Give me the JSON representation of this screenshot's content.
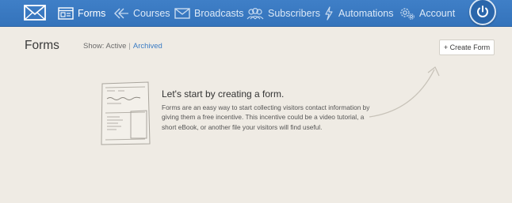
{
  "nav": {
    "items": [
      {
        "label": "Forms",
        "icon": "form-icon",
        "active": true
      },
      {
        "label": "Courses",
        "icon": "courses-icon",
        "active": false
      },
      {
        "label": "Broadcasts",
        "icon": "broadcast-icon",
        "active": false
      },
      {
        "label": "Subscribers",
        "icon": "subscribers-icon",
        "active": false
      },
      {
        "label": "Automations",
        "icon": "lightning-icon",
        "active": false
      },
      {
        "label": "Account",
        "icon": "gear-icon",
        "active": false
      }
    ],
    "colors": {
      "bar": "#3776be",
      "text": "#dce9f7",
      "active_text": "#ffffff"
    }
  },
  "page": {
    "title": "Forms",
    "filter": {
      "prefix": "Show:",
      "active": "Active",
      "separator": "|",
      "archived": "Archived"
    },
    "create_button": "+ Create Form"
  },
  "empty_state": {
    "heading": "Let's start by creating a form.",
    "body": "Forms are an easy way to start collecting visitors contact information by giving them a free incentive. This incentive could be a video tutorial, a short eBook, or another file your visitors will find useful."
  },
  "colors": {
    "background": "#efebe4",
    "link": "#3b7cc4"
  }
}
